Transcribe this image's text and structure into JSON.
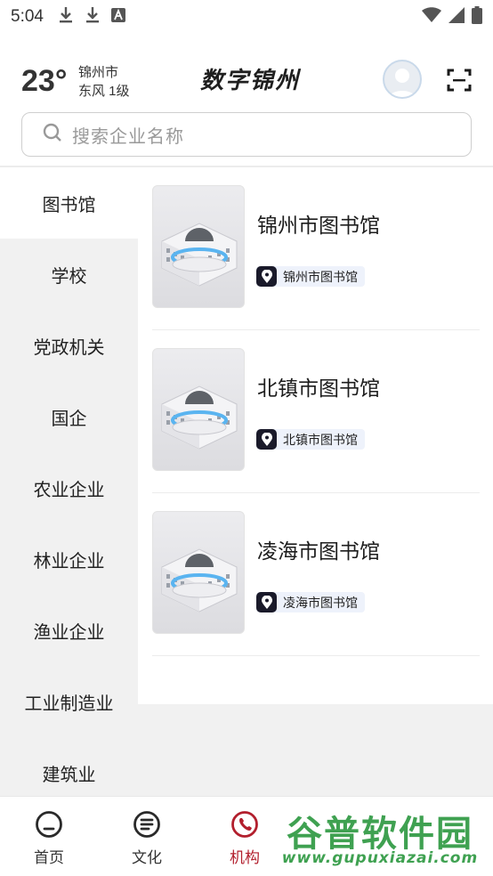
{
  "status_bar": {
    "time": "5:04",
    "icons": [
      "download-icon",
      "download-icon",
      "font-icon",
      "wifi-icon",
      "signal-icon",
      "battery-icon"
    ]
  },
  "header": {
    "temperature": "23°",
    "city": "锦州市",
    "wind": "东风 1级",
    "app_title": "数字锦州"
  },
  "search": {
    "placeholder": "搜索企业名称"
  },
  "sidebar": {
    "items": [
      {
        "label": "图书馆",
        "active": true
      },
      {
        "label": "学校"
      },
      {
        "label": "党政机关"
      },
      {
        "label": "国企"
      },
      {
        "label": "农业企业"
      },
      {
        "label": "林业企业"
      },
      {
        "label": "渔业企业"
      },
      {
        "label": "工业制造业"
      },
      {
        "label": "建筑业"
      }
    ]
  },
  "list": {
    "items": [
      {
        "title": "锦州市图书馆",
        "tag": "锦州市图书馆"
      },
      {
        "title": "北镇市图书馆",
        "tag": "北镇市图书馆"
      },
      {
        "title": "凌海市图书馆",
        "tag": "凌海市图书馆"
      }
    ]
  },
  "bottom_nav": {
    "items": [
      {
        "label": "首页",
        "icon": "home-icon"
      },
      {
        "label": "文化",
        "icon": "culture-icon"
      },
      {
        "label": "机构",
        "icon": "phone-icon",
        "active": true
      }
    ]
  },
  "watermark": {
    "title": "谷普软件园",
    "url": "www.gupuxiazai.com"
  },
  "colors": {
    "accent": "#b21f2d",
    "sidebar_bg": "#f1f1f1",
    "tag_bg": "#eef2fb",
    "watermark": "#2f9a43"
  }
}
